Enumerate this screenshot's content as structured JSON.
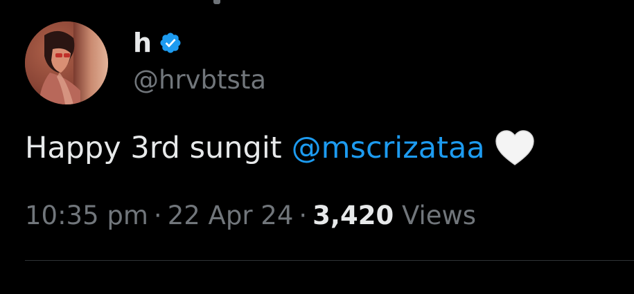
{
  "author": {
    "display_name": "h",
    "handle": "@hrvbtsta",
    "verified": true,
    "verified_color": "#1d9bf0",
    "avatar": "profile-photo"
  },
  "tweet": {
    "text": "Happy 3rd sungit",
    "mention": "@mscrizataa",
    "emoji": "white-heart-icon"
  },
  "meta": {
    "time": "10:35 pm",
    "separator": "·",
    "date": "22 Apr 24",
    "views_count": "3,420",
    "views_label": "Views"
  },
  "colors": {
    "background": "#000000",
    "text_primary": "#e7e9ea",
    "text_secondary": "#71767b",
    "accent": "#1d9bf0",
    "divider": "#2f3336"
  }
}
